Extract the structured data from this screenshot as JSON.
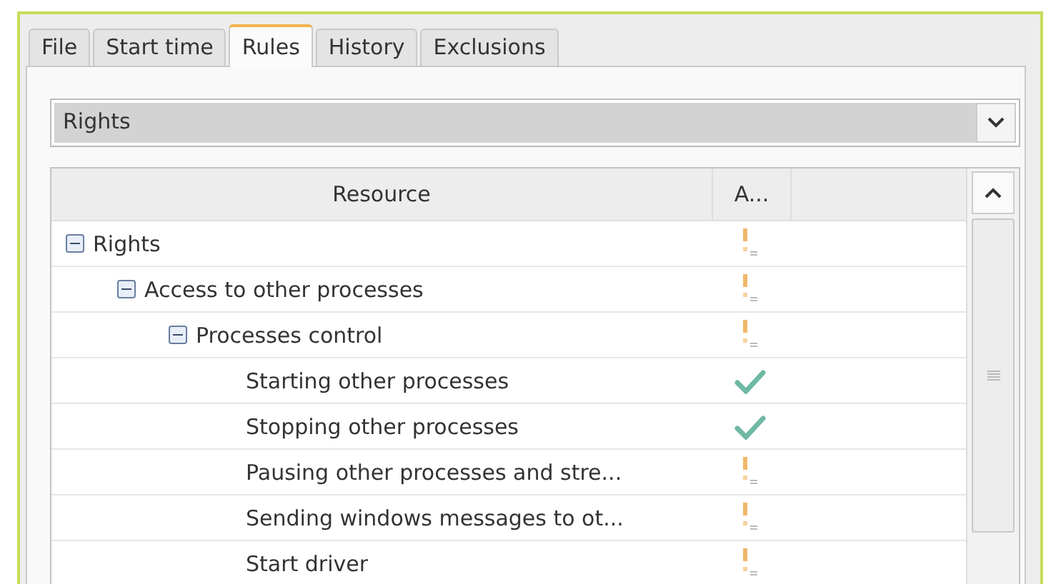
{
  "tabs": [
    {
      "label": "File",
      "selected": false
    },
    {
      "label": "Start time",
      "selected": false
    },
    {
      "label": "Rules",
      "selected": true
    },
    {
      "label": "History",
      "selected": false
    },
    {
      "label": "Exclusions",
      "selected": false
    }
  ],
  "dropdown": {
    "value": "Rights"
  },
  "table": {
    "columns": [
      "Resource",
      "A..."
    ],
    "rows": [
      {
        "label": "Rights",
        "kind": "ask",
        "expanded": true,
        "children": [
          {
            "label": "Access to other processes",
            "kind": "ask",
            "expanded": true,
            "children": [
              {
                "label": "Processes control",
                "kind": "ask",
                "expanded": true,
                "children": [
                  {
                    "label": "Starting other processes",
                    "kind": "allow"
                  },
                  {
                    "label": "Stopping other processes",
                    "kind": "allow"
                  },
                  {
                    "label": "Pausing other processes and stre...",
                    "kind": "ask"
                  },
                  {
                    "label": "Sending windows messages to ot...",
                    "kind": "ask"
                  },
                  {
                    "label": "Start driver",
                    "kind": "ask"
                  }
                ]
              }
            ]
          }
        ]
      }
    ]
  }
}
